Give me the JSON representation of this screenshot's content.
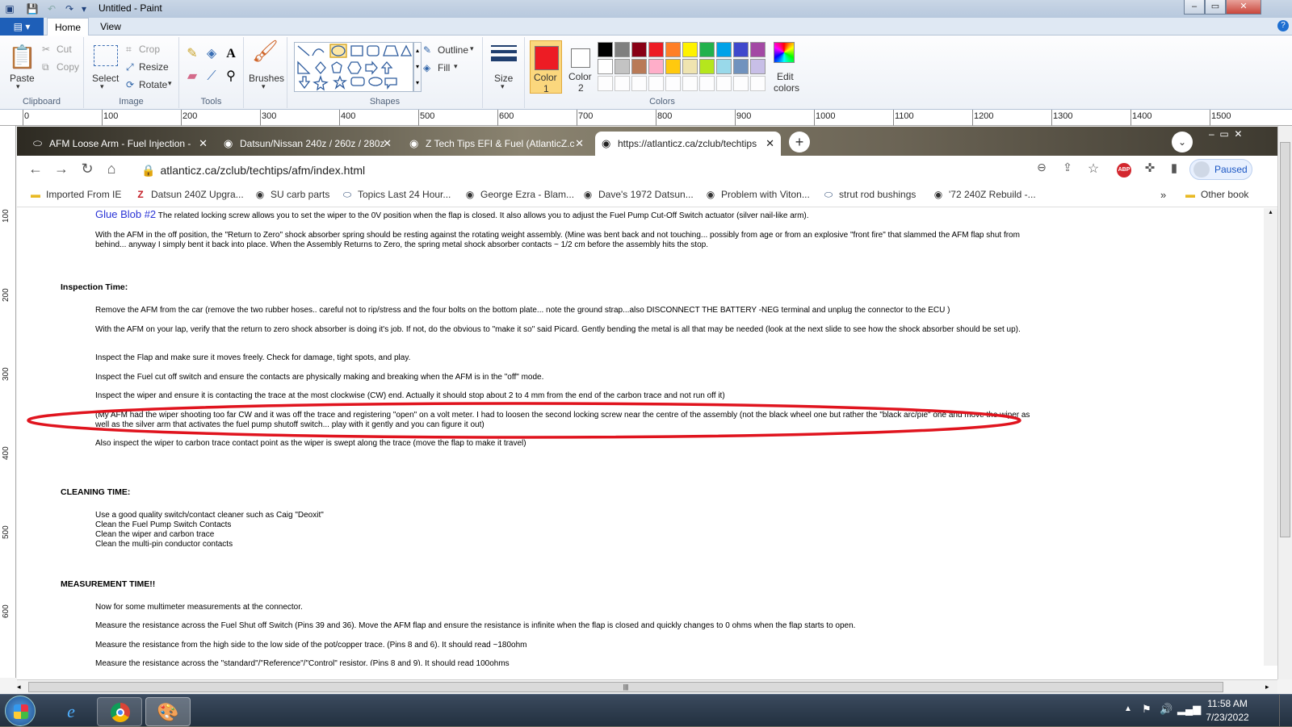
{
  "paint": {
    "title": "Untitled - Paint",
    "file_tab": "▤ ▾",
    "tabs": [
      "Home",
      "View"
    ],
    "clipboard": {
      "paste": "Paste",
      "cut": "Cut",
      "copy": "Copy",
      "group": "Clipboard"
    },
    "image": {
      "select": "Select",
      "crop": "Crop",
      "resize": "Resize",
      "rotate": "Rotate",
      "group": "Image"
    },
    "tools": {
      "group": "Tools"
    },
    "brushes": "Brushes",
    "shapes": {
      "outline": "Outline",
      "fill": "Fill",
      "group": "Shapes"
    },
    "size": "Size",
    "color1": {
      "label": "Color",
      "num": "1",
      "value": "#ed1c24"
    },
    "color2": {
      "label": "Color",
      "num": "2",
      "value": "#ffffff"
    },
    "colors_group": "Colors",
    "edit_colors": {
      "line1": "Edit",
      "line2": "colors"
    },
    "palette": [
      "#000000",
      "#7f7f7f",
      "#880015",
      "#ed1c24",
      "#ff7f27",
      "#fff200",
      "#22b14c",
      "#00a2e8",
      "#3f48cc",
      "#a349a4",
      "#ffffff",
      "#c3c3c3",
      "#b97a57",
      "#ffaec9",
      "#ffc90e",
      "#efe4b0",
      "#b5e61d",
      "#99d9ea",
      "#7092be",
      "#c8bfe7"
    ],
    "ruler_labels": [
      "0",
      "100",
      "200",
      "300",
      "400",
      "500",
      "600",
      "700",
      "800",
      "900",
      "1000",
      "1100",
      "1200",
      "1300",
      "1400",
      "1500"
    ],
    "vruler_labels": [
      "100",
      "200",
      "300",
      "400",
      "500",
      "600"
    ]
  },
  "browser": {
    "tabs": [
      {
        "title": "AFM Loose Arm - Fuel Injection -",
        "fav": "⬭"
      },
      {
        "title": "Datsun/Nissan 240z / 260z / 280z",
        "fav": "◉"
      },
      {
        "title": "Z Tech Tips EFI & Fuel (AtlanticZ.c",
        "fav": "◉"
      },
      {
        "title": "https://atlanticz.ca/zclub/techtips",
        "fav": "◉"
      }
    ],
    "url": "atlanticz.ca/zclub/techtips/afm/index.html",
    "paused": "Paused",
    "bookmarks": [
      {
        "label": "Imported From IE",
        "icon": "▬"
      },
      {
        "label": "Datsun 240Z Upgra...",
        "icon": "Z"
      },
      {
        "label": "SU carb parts",
        "icon": "◉"
      },
      {
        "label": "Topics Last 24 Hour...",
        "icon": "⬭"
      },
      {
        "label": "George Ezra - Blam...",
        "icon": "◉"
      },
      {
        "label": "Dave's 1972 Datsun...",
        "icon": "◉"
      },
      {
        "label": "Problem with Viton...",
        "icon": "◉"
      },
      {
        "label": "strut rod bushings",
        "icon": "⬭"
      },
      {
        "label": "'72 240Z Rebuild -...",
        "icon": "◉"
      }
    ],
    "other_bookmarks": "Other book"
  },
  "page": {
    "glue_blob": "Glue Blob #2",
    "p0": "The related locking screw allows you to set the wiper to the 0V position when the flap is closed. It also allows you to adjust the Fuel Pump Cut-Off Switch actuator (silver nail-like arm).",
    "p1": "With the AFM in the off position, the \"Return to Zero\" shock absorber spring should be resting against the rotating weight assembly. (Mine was bent back and not touching... possibly from age or from an explosive \"front fire\" that slammed the AFM flap shut from behind... anyway I simply bent it back into place. When the Assembly Returns to Zero, the spring metal shock absorber contacts ~ 1/2 cm before the assembly hits the stop.",
    "h_inspection": "Inspection Time:",
    "i1": "Remove the AFM from the car (remove the two rubber hoses.. careful not to rip/stress and the four bolts on the bottom plate... note the ground strap...also DISCONNECT THE BATTERY -NEG terminal and unplug the connector to the ECU )",
    "i2": "With the AFM on your lap, verify that the return to zero shock absorber is doing it's job. If not, do the obvious to \"make it so\" said Picard. Gently bending the metal is all that may be needed (look at the next slide to see how the shock absorber should be set up).",
    "i3": "Inspect the Flap and make sure it moves freely. Check for damage, tight spots, and play.",
    "i4": "Inspect the Fuel cut off switch and ensure the contacts are physically making and breaking when the AFM is in the \"off\" mode.",
    "i5": "Inspect the wiper and ensure it is contacting the trace at the most clockwise (CW) end. Actually it should stop about 2 to 4 mm from the end of the carbon trace and not run off it)",
    "i6": "(My AFM had the wiper shooting too far CW and it was off the trace and registering \"open\" on a volt meter. I had to loosen the second locking screw near the centre of the assembly (not the black wheel one but rather the \"black arc/pie\" one and move the wiper as well as the silver arm that activates the fuel pump shutoff switch... play with it gently and you can figure it out)",
    "i7": "Also inspect the wiper to carbon trace contact point as the wiper is swept along the trace (move the flap to make it travel)",
    "h_cleaning": "CLEANING TIME:",
    "c1": "Use a good quality switch/contact cleaner such as Caig \"Deoxit\"",
    "c2": "Clean the Fuel Pump Switch Contacts",
    "c3": "Clean the wiper and carbon trace",
    "c4": "Clean the multi-pin conductor contacts",
    "h_measure": "MEASUREMENT TIME!!",
    "m1": "Now for some multimeter measurements at the connector.",
    "m2": "Measure the resistance across the Fuel Shut off Switch (Pins 39 and 36). Move the AFM flap and ensure the resistance is infinite when the flap is closed and quickly changes to 0 ohms when the flap starts to open.",
    "m3": "Measure the resistance from the high side to the low side of the pot/copper trace. (Pins 8 and 6). It should read ~180ohm",
    "m4": "Measure the resistance across the \"standard\"/\"Reference\"/\"Control\" resistor. (Pins 8 and 9). It should read 100ohms"
  },
  "taskbar": {
    "time": "11:58 AM",
    "date": "7/23/2022"
  },
  "annotation_color": "#e0141e"
}
